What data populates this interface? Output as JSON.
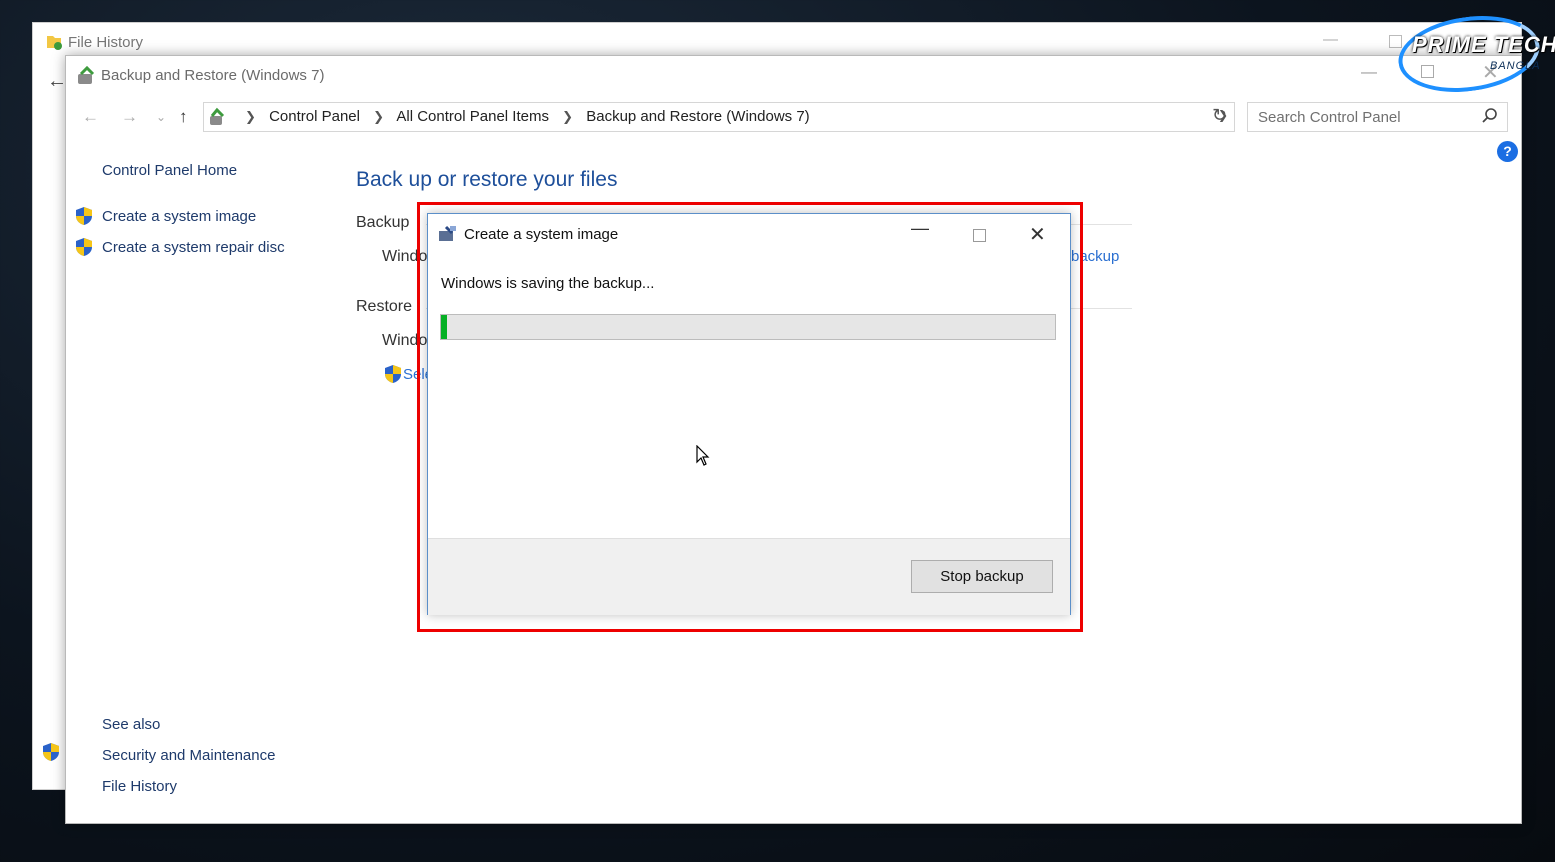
{
  "back_window": {
    "title": "File History"
  },
  "window": {
    "title": "Backup and Restore (Windows 7)"
  },
  "address_bar": {
    "breadcrumbs": [
      "Control Panel",
      "All Control Panel Items",
      "Backup and Restore (Windows 7)"
    ]
  },
  "search": {
    "placeholder": "Search Control Panel"
  },
  "sidebar": {
    "home": "Control Panel Home",
    "items": [
      {
        "label": "Create a system image",
        "icon": "shield-icon"
      },
      {
        "label": "Create a system repair disc",
        "icon": "shield-icon"
      }
    ],
    "see_also_heading": "See also",
    "see_also": [
      "Security and Maintenance",
      "File History"
    ]
  },
  "main": {
    "title": "Back up or restore your files",
    "backup_heading": "Backup",
    "backup_partial_text": "Windo",
    "backup_partial_link": "backup",
    "restore_heading": "Restore",
    "restore_partial_text": "Windo",
    "restore_partial_link": "Sele"
  },
  "dialog": {
    "title": "Create a system image",
    "message": "Windows is saving the backup...",
    "progress_fraction": 0.01,
    "stop_button": "Stop backup"
  },
  "colors": {
    "highlight_frame": "#ee0000",
    "progress_fill": "#06b025",
    "link": "#1e3a6b",
    "heading": "#1e4f9a"
  },
  "watermark": {
    "text": "PRIME TECH",
    "subtext": "BANGLA"
  }
}
